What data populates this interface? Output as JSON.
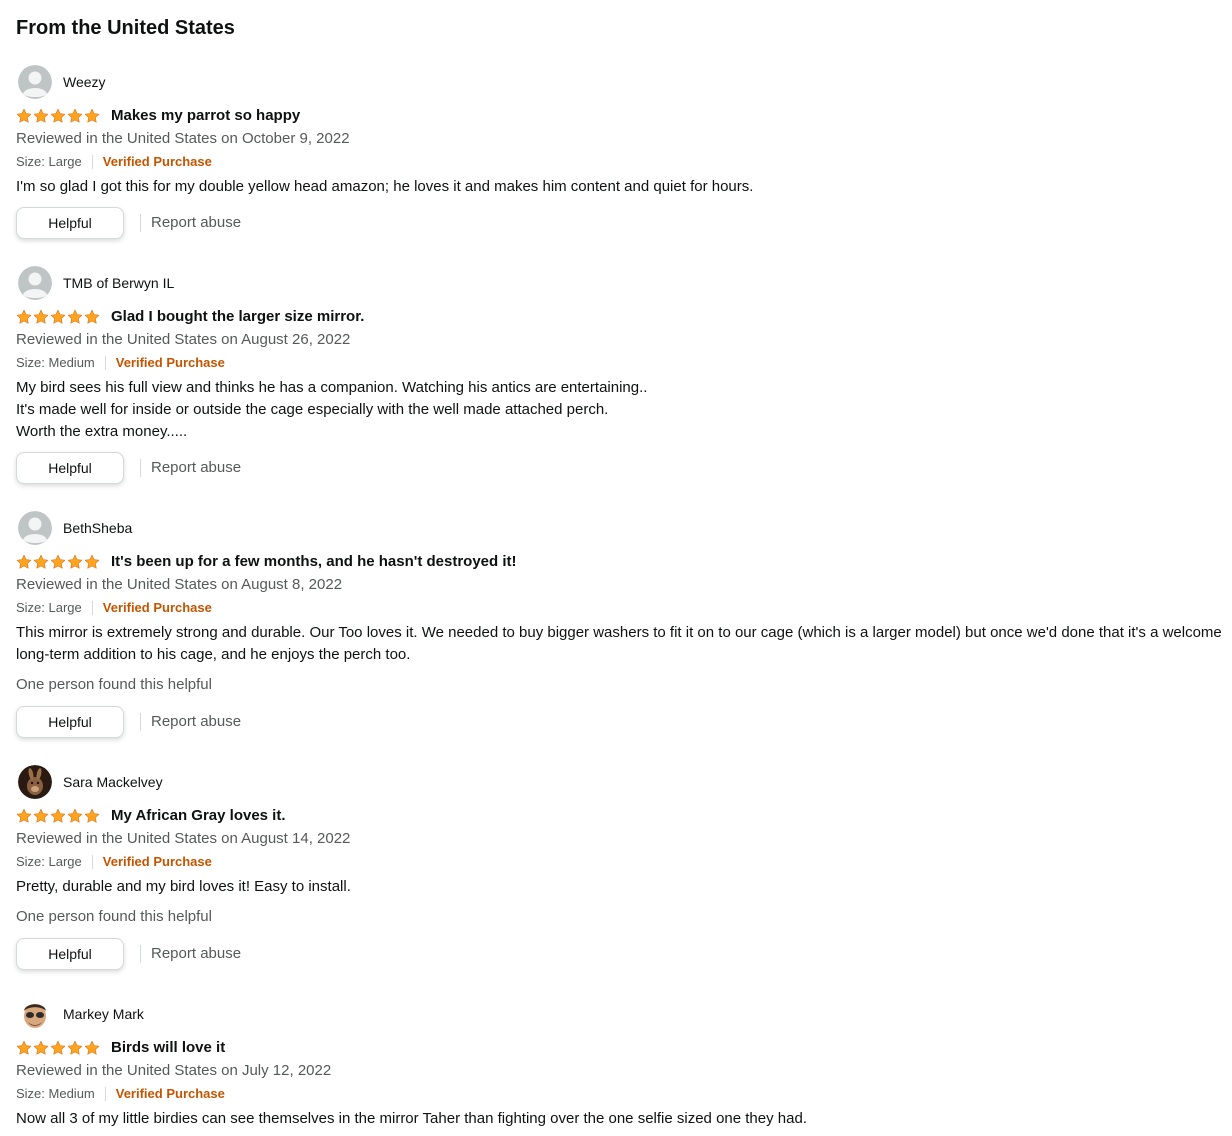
{
  "section": {
    "title": "From the United States"
  },
  "colors": {
    "star": "#ffa41c",
    "verified": "#c45500",
    "secondary_text": "#565959"
  },
  "reviews": [
    {
      "reviewer": "Weezy",
      "avatar": "default-avatar-icon",
      "rating": 5,
      "title": "Makes my parrot so happy",
      "date": "Reviewed in the United States on October 9, 2022",
      "size": "Size: Large",
      "verified": "Verified Purchase",
      "body": [
        "I'm so glad I got this for my double yellow head amazon; he loves it and makes him content and quiet for hours."
      ],
      "helpful_count": "",
      "helpful_label": "Helpful",
      "report_label": "Report abuse"
    },
    {
      "reviewer": "TMB of Berwyn IL",
      "avatar": "default-avatar-icon",
      "rating": 5,
      "title": "Glad I bought the larger size mirror.",
      "date": "Reviewed in the United States on August 26, 2022",
      "size": "Size: Medium",
      "verified": "Verified Purchase",
      "body": [
        "My bird sees his full view and thinks he has a companion. Watching his antics are entertaining..",
        "It's made well for inside or outside the cage especially with the well made attached perch.",
        "Worth the extra money....."
      ],
      "helpful_count": "",
      "helpful_label": "Helpful",
      "report_label": "Report abuse"
    },
    {
      "reviewer": "BethSheba",
      "avatar": "default-avatar-icon",
      "rating": 5,
      "title": "It's been up for a few months, and he hasn't destroyed it!",
      "date": "Reviewed in the United States on August 8, 2022",
      "size": "Size: Large",
      "verified": "Verified Purchase",
      "body": [
        "This mirror is extremely strong and durable. Our Too loves it. We needed to buy bigger washers to fit it on to our cage (which is a larger model) but once we'd done that it's a welcome long-term addition to his cage, and he enjoys the perch too."
      ],
      "helpful_count": "One person found this helpful",
      "helpful_label": "Helpful",
      "report_label": "Report abuse"
    },
    {
      "reviewer": "Sara Mackelvey",
      "avatar": "rabbit-photo-avatar-icon",
      "rating": 5,
      "title": "My African Gray loves it.",
      "date": "Reviewed in the United States on August 14, 2022",
      "size": "Size: Large",
      "verified": "Verified Purchase",
      "body": [
        "Pretty, durable and my bird loves it! Easy to install."
      ],
      "helpful_count": "One person found this helpful",
      "helpful_label": "Helpful",
      "report_label": "Report abuse"
    },
    {
      "reviewer": "Markey Mark",
      "avatar": "cartoon-face-avatar-icon",
      "rating": 5,
      "title": "Birds will love it",
      "date": "Reviewed in the United States on July 12, 2022",
      "size": "Size: Medium",
      "verified": "Verified Purchase",
      "body": [
        "Now all 3 of my little birdies can see themselves in the mirror Taher than fighting over the one selfie sized one they had."
      ],
      "helpful_count": "",
      "helpful_label": "",
      "report_label": ""
    }
  ]
}
